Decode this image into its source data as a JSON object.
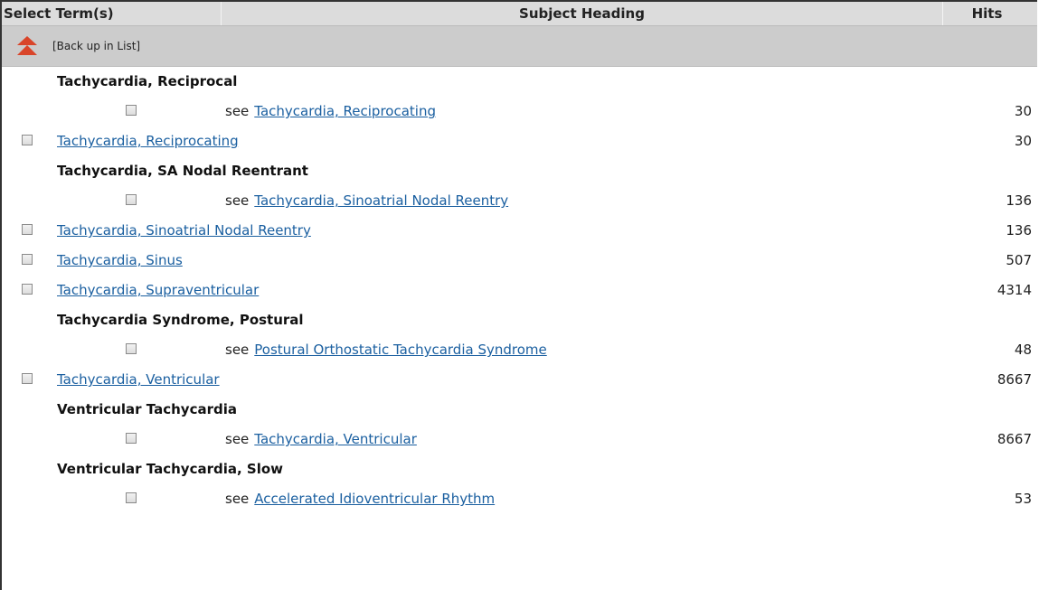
{
  "header": {
    "select_label": "Select Term(s)",
    "subject_label": "Subject Heading",
    "hits_label": "Hits"
  },
  "back": {
    "label": "[Back up in List]"
  },
  "colors": {
    "link": "#1a5fa0",
    "header_bg": "#dcdcdc",
    "back_bg": "#cccccc",
    "arrow": "#d9452a"
  },
  "rows": [
    {
      "type": "heading",
      "text": "Tachycardia, Reciprocal"
    },
    {
      "type": "see",
      "see": "see",
      "link": "Tachycardia, Reciprocating",
      "hits": "30"
    },
    {
      "type": "term",
      "link": "Tachycardia, Reciprocating",
      "hits": "30"
    },
    {
      "type": "heading",
      "text": "Tachycardia, SA Nodal Reentrant"
    },
    {
      "type": "see",
      "see": "see",
      "link": "Tachycardia, Sinoatrial Nodal Reentry",
      "hits": "136"
    },
    {
      "type": "term",
      "link": "Tachycardia, Sinoatrial Nodal Reentry",
      "hits": "136"
    },
    {
      "type": "term",
      "link": "Tachycardia, Sinus",
      "hits": "507"
    },
    {
      "type": "term",
      "link": "Tachycardia, Supraventricular",
      "hits": "4314"
    },
    {
      "type": "heading",
      "text": "Tachycardia Syndrome, Postural"
    },
    {
      "type": "see",
      "see": "see",
      "link": "Postural Orthostatic Tachycardia Syndrome",
      "hits": "48"
    },
    {
      "type": "term",
      "link": "Tachycardia, Ventricular",
      "hits": "8667"
    },
    {
      "type": "heading",
      "text": "Ventricular Tachycardia"
    },
    {
      "type": "see",
      "see": "see",
      "link": "Tachycardia, Ventricular",
      "hits": "8667"
    },
    {
      "type": "heading",
      "text": "Ventricular Tachycardia, Slow"
    },
    {
      "type": "see",
      "see": "see",
      "link": "Accelerated Idioventricular Rhythm",
      "hits": "53"
    }
  ]
}
